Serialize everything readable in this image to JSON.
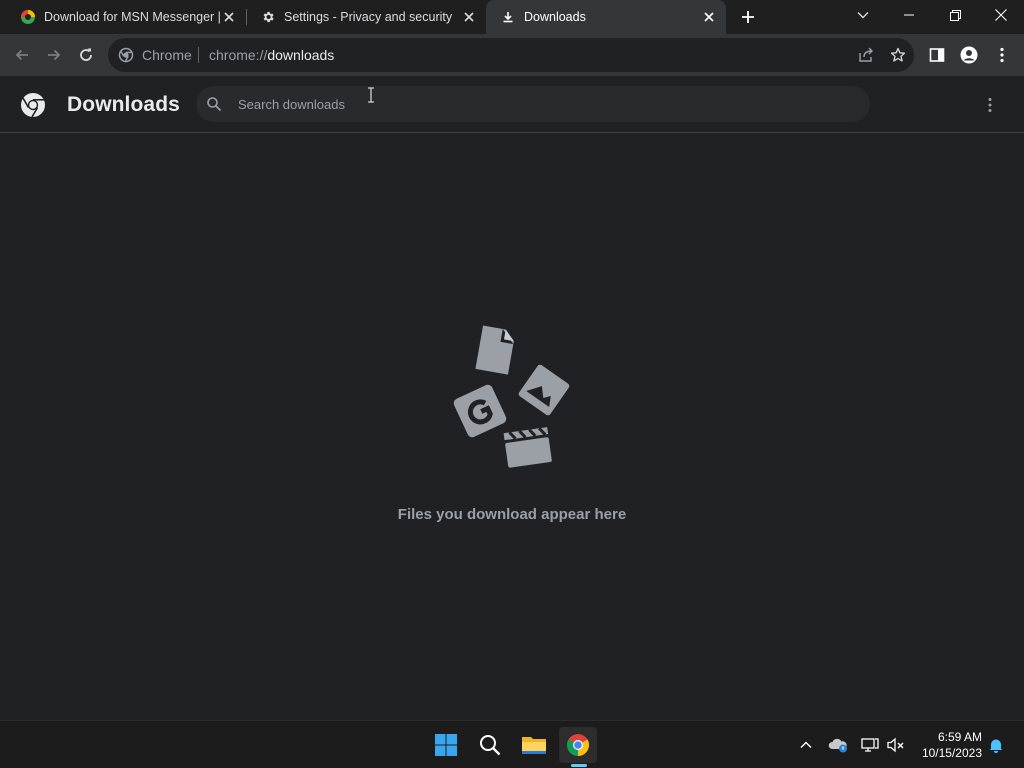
{
  "tabs": [
    {
      "title": "Download for MSN Messenger |",
      "icon": "msn-favicon",
      "active": false
    },
    {
      "title": "Settings - Privacy and security",
      "icon": "gear-icon",
      "active": false
    },
    {
      "title": "Downloads",
      "icon": "download-icon",
      "active": true
    }
  ],
  "omnibox": {
    "chip": "Chrome",
    "url_scheme": "chrome://",
    "url_host": "downloads"
  },
  "page": {
    "title": "Downloads",
    "search_placeholder": "Search downloads",
    "empty_message": "Files you download appear here"
  },
  "taskbar": {
    "apps": [
      "windows-start",
      "search",
      "file-explorer",
      "chrome"
    ],
    "time": "6:59 AM",
    "date": "10/15/2023"
  },
  "colors": {
    "background": "#202124",
    "tabstrip": "#1f1f1f",
    "toolbar": "#35363a",
    "accent": "#60cdff",
    "illustration": "#9aa0a6"
  }
}
